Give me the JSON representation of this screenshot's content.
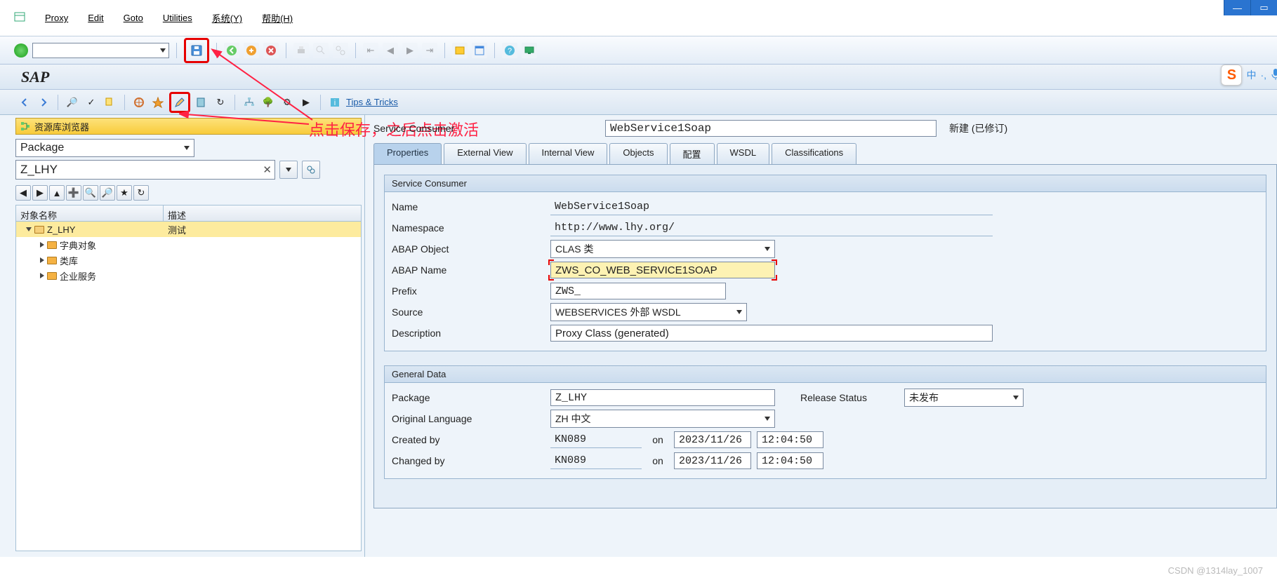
{
  "menu": {
    "items": [
      "Proxy",
      "Edit",
      "Goto",
      "Utilities",
      "系统(Y)",
      "帮助(H)"
    ]
  },
  "toolbar1": {
    "save_icon": "save-icon",
    "icons": [
      "back",
      "cancel",
      "stop",
      "print",
      "find",
      "find-next",
      "sep",
      "first",
      "prev",
      "next",
      "last",
      "sep",
      "new-window",
      "layout",
      "sep",
      "help",
      "screen"
    ]
  },
  "sap_title": "SAP",
  "toolbar2": {
    "tips_label": "Tips & Tricks"
  },
  "annotation": {
    "text": "点击保存，之后点击激活"
  },
  "left": {
    "browser_title": "资源库浏览器",
    "package_dd": "Package",
    "package_value": "Z_LHY",
    "tree_header": {
      "name": "对象名称",
      "desc": "描述"
    },
    "tree": [
      {
        "label": "Z_LHY",
        "desc": "测试",
        "level": 0,
        "open": true,
        "selected": true
      },
      {
        "label": "字典对象",
        "desc": "",
        "level": 1,
        "open": false
      },
      {
        "label": "类库",
        "desc": "",
        "level": 1,
        "open": false
      },
      {
        "label": "企业服务",
        "desc": "",
        "level": 1,
        "open": false
      }
    ]
  },
  "right": {
    "header_label": "Service Consumer",
    "header_value": "WebService1Soap",
    "header_status": "新建 (已修订)",
    "tabs": [
      "Properties",
      "External View",
      "Internal View",
      "Objects",
      "配置",
      "WSDL",
      "Classifications"
    ],
    "active_tab": 0,
    "group1": {
      "title": "Service Consumer",
      "name_label": "Name",
      "name_value": "WebService1Soap",
      "namespace_label": "Namespace",
      "namespace_value": "http://www.lhy.org/",
      "abap_object_label": "ABAP Object",
      "abap_object_value": "CLAS 类",
      "abap_name_label": "ABAP Name",
      "abap_name_value": "ZWS_CO_WEB_SERVICE1SOAP",
      "prefix_label": "Prefix",
      "prefix_value": "ZWS_",
      "source_label": "Source",
      "source_value": "WEBSERVICES 外部 WSDL",
      "description_label": "Description",
      "description_value": "Proxy Class (generated)"
    },
    "group2": {
      "title": "General Data",
      "package_label": "Package",
      "package_value": "Z_LHY",
      "release_status_label": "Release Status",
      "release_status_value": "未发布",
      "orig_lang_label": "Original Language",
      "orig_lang_value": "ZH 中文",
      "created_by_label": "Created by",
      "created_by_value": "KN089",
      "on_label": "on",
      "created_date": "2023/11/26",
      "created_time": "12:04:50",
      "changed_by_label": "Changed by",
      "changed_by_value": "KN089",
      "changed_date": "2023/11/26",
      "changed_time": "12:04:50"
    }
  },
  "ime": {
    "s": "S",
    "lang": "中",
    "dot": "·,"
  },
  "watermark": "CSDN @1314lay_1007"
}
